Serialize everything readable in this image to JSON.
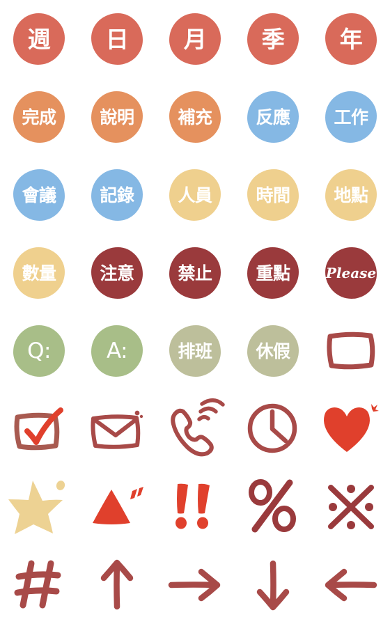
{
  "sheet": {
    "title": "Hand-drawn Chinese label emoji sticker sheet",
    "background": "#ffffff",
    "columns": 5,
    "rows": 8
  },
  "palette": {
    "coral_red": "#D96A5A",
    "orange": "#E5915E",
    "blue": "#85B8E4",
    "gold": "#EFD08E",
    "maroon": "#9A3A3C",
    "green": "#A8BE88",
    "sage": "#BDBF9B",
    "brick": "#A85A50",
    "bright_red": "#E0402C",
    "text_white": "#FFFFFF"
  },
  "stickers": [
    {
      "row": 1,
      "col": 1,
      "kind": "bubble",
      "label": "週",
      "fill": "#D96A5A",
      "name": "sticker-week"
    },
    {
      "row": 1,
      "col": 2,
      "kind": "bubble",
      "label": "日",
      "fill": "#D96A5A",
      "name": "sticker-day"
    },
    {
      "row": 1,
      "col": 3,
      "kind": "bubble",
      "label": "月",
      "fill": "#D96A5A",
      "name": "sticker-month"
    },
    {
      "row": 1,
      "col": 4,
      "kind": "bubble",
      "label": "季",
      "fill": "#D96A5A",
      "name": "sticker-season"
    },
    {
      "row": 1,
      "col": 5,
      "kind": "bubble",
      "label": "年",
      "fill": "#D96A5A",
      "name": "sticker-year"
    },
    {
      "row": 2,
      "col": 1,
      "kind": "bubble",
      "label": "完成",
      "fill": "#E5915E",
      "name": "sticker-complete"
    },
    {
      "row": 2,
      "col": 2,
      "kind": "bubble",
      "label": "說明",
      "fill": "#E5915E",
      "name": "sticker-explanation"
    },
    {
      "row": 2,
      "col": 3,
      "kind": "bubble",
      "label": "補充",
      "fill": "#E5915E",
      "name": "sticker-supplement"
    },
    {
      "row": 2,
      "col": 4,
      "kind": "bubble",
      "label": "反應",
      "fill": "#85B8E4",
      "name": "sticker-response"
    },
    {
      "row": 2,
      "col": 5,
      "kind": "bubble",
      "label": "工作",
      "fill": "#85B8E4",
      "name": "sticker-work"
    },
    {
      "row": 3,
      "col": 1,
      "kind": "bubble",
      "label": "會議",
      "fill": "#85B8E4",
      "name": "sticker-meeting"
    },
    {
      "row": 3,
      "col": 2,
      "kind": "bubble",
      "label": "記錄",
      "fill": "#85B8E4",
      "name": "sticker-record"
    },
    {
      "row": 3,
      "col": 3,
      "kind": "bubble",
      "label": "人員",
      "fill": "#EFD08E",
      "name": "sticker-personnel"
    },
    {
      "row": 3,
      "col": 4,
      "kind": "bubble",
      "label": "時間",
      "fill": "#EFD08E",
      "name": "sticker-time"
    },
    {
      "row": 3,
      "col": 5,
      "kind": "bubble",
      "label": "地點",
      "fill": "#EFD08E",
      "name": "sticker-location"
    },
    {
      "row": 4,
      "col": 1,
      "kind": "bubble",
      "label": "數量",
      "fill": "#EFD08E",
      "name": "sticker-quantity"
    },
    {
      "row": 4,
      "col": 2,
      "kind": "bubble",
      "label": "注意",
      "fill": "#9A3A3C",
      "name": "sticker-attention"
    },
    {
      "row": 4,
      "col": 3,
      "kind": "bubble",
      "label": "禁止",
      "fill": "#9A3A3C",
      "name": "sticker-prohibited"
    },
    {
      "row": 4,
      "col": 4,
      "kind": "bubble",
      "label": "重點",
      "fill": "#9A3A3C",
      "name": "sticker-key-point"
    },
    {
      "row": 4,
      "col": 5,
      "kind": "bubble",
      "label": "Please",
      "fill": "#9A3A3C",
      "name": "sticker-please"
    },
    {
      "row": 5,
      "col": 1,
      "kind": "bubble",
      "label": "Q:",
      "fill": "#A8BE88",
      "name": "sticker-question"
    },
    {
      "row": 5,
      "col": 2,
      "kind": "bubble",
      "label": "A:",
      "fill": "#A8BE88",
      "name": "sticker-answer"
    },
    {
      "row": 5,
      "col": 3,
      "kind": "bubble",
      "label": "排班",
      "fill": "#BDBF9B",
      "name": "sticker-shift-schedule"
    },
    {
      "row": 5,
      "col": 4,
      "kind": "bubble",
      "label": "休假",
      "fill": "#BDBF9B",
      "name": "sticker-vacation"
    },
    {
      "row": 5,
      "col": 5,
      "kind": "icon",
      "icon": "empty-checkbox-icon",
      "label": "",
      "fill": "#A84A48",
      "name": "sticker-empty-checkbox"
    },
    {
      "row": 6,
      "col": 1,
      "kind": "icon",
      "icon": "checked-checkbox-icon",
      "label": "",
      "fill": "#A85A50",
      "accent": "#E0402C",
      "name": "sticker-checked-checkbox"
    },
    {
      "row": 6,
      "col": 2,
      "kind": "icon",
      "icon": "envelope-icon",
      "label": "",
      "fill": "#A84A48",
      "name": "sticker-envelope"
    },
    {
      "row": 6,
      "col": 3,
      "kind": "icon",
      "icon": "ringing-phone-icon",
      "label": "",
      "fill": "#A84A48",
      "name": "sticker-phone"
    },
    {
      "row": 6,
      "col": 4,
      "kind": "icon",
      "icon": "clock-icon",
      "label": "",
      "fill": "#A84A48",
      "name": "sticker-clock"
    },
    {
      "row": 6,
      "col": 5,
      "kind": "icon",
      "icon": "heart-icon",
      "label": "",
      "fill": "#E0402C",
      "name": "sticker-heart"
    },
    {
      "row": 7,
      "col": 1,
      "kind": "icon",
      "icon": "star-icon",
      "label": "",
      "fill": "#EDD293",
      "name": "sticker-star"
    },
    {
      "row": 7,
      "col": 2,
      "kind": "icon",
      "icon": "triangle-icon",
      "label": "",
      "fill": "#E0402C",
      "name": "sticker-triangle"
    },
    {
      "row": 7,
      "col": 3,
      "kind": "icon",
      "icon": "double-exclamation-icon",
      "label": "!!",
      "fill": "#E0402C",
      "name": "sticker-double-exclamation"
    },
    {
      "row": 7,
      "col": 4,
      "kind": "icon",
      "icon": "percent-icon",
      "label": "%",
      "fill": "#9A3A3C",
      "name": "sticker-percent"
    },
    {
      "row": 7,
      "col": 5,
      "kind": "icon",
      "icon": "reference-mark-icon",
      "label": "※",
      "fill": "#9A3A3C",
      "name": "sticker-reference-mark"
    },
    {
      "row": 8,
      "col": 1,
      "kind": "icon",
      "icon": "hash-icon",
      "label": "#",
      "fill": "#A84A48",
      "name": "sticker-hash"
    },
    {
      "row": 8,
      "col": 2,
      "kind": "icon",
      "icon": "arrow-up-icon",
      "label": "",
      "fill": "#A84A48",
      "name": "sticker-arrow-up"
    },
    {
      "row": 8,
      "col": 3,
      "kind": "icon",
      "icon": "arrow-right-icon",
      "label": "",
      "fill": "#A84A48",
      "name": "sticker-arrow-right"
    },
    {
      "row": 8,
      "col": 4,
      "kind": "icon",
      "icon": "arrow-down-icon",
      "label": "",
      "fill": "#A84A48",
      "name": "sticker-arrow-down"
    },
    {
      "row": 8,
      "col": 5,
      "kind": "icon",
      "icon": "arrow-left-icon",
      "label": "",
      "fill": "#A84A48",
      "name": "sticker-arrow-left"
    }
  ]
}
